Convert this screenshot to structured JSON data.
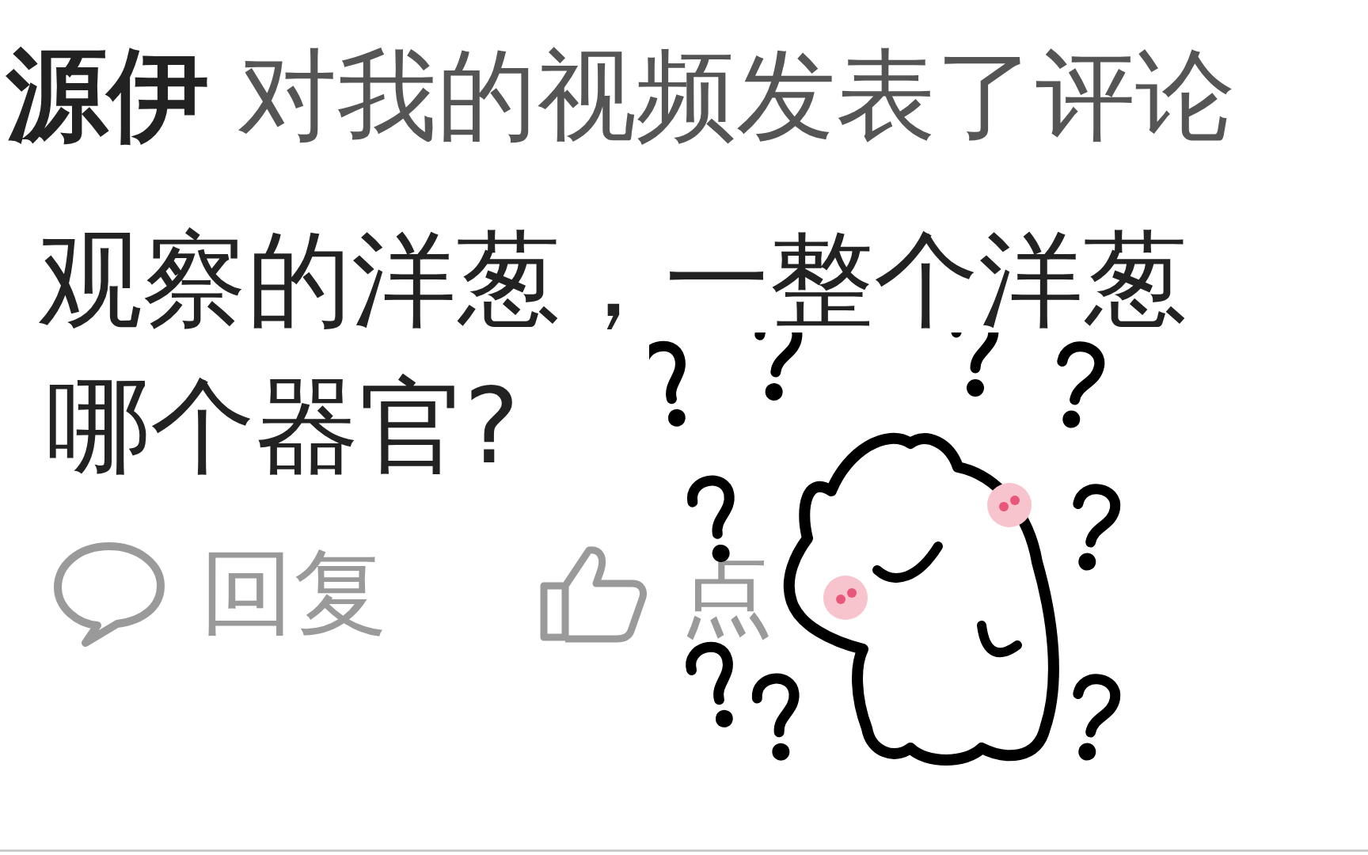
{
  "notification": {
    "user": "源伊",
    "action": "对我的视频发表了评论"
  },
  "comment_lines": [
    "观察的洋葱，一整个洋葱",
    "哪个器官?"
  ],
  "actions": [
    {
      "kind": "reply",
      "label": "回复"
    },
    {
      "kind": "like",
      "label": "点"
    }
  ]
}
